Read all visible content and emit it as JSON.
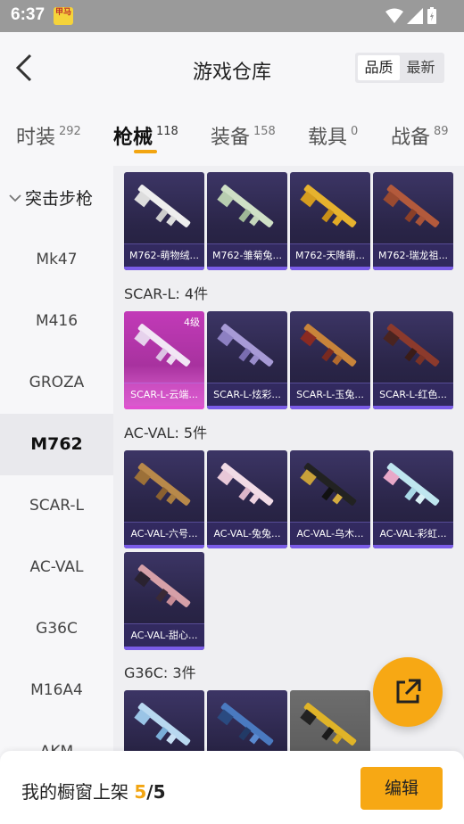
{
  "status": {
    "time": "6:37",
    "app_icon_text": "甲马"
  },
  "header": {
    "title": "游戏仓库",
    "sort": [
      "品质",
      "最新"
    ]
  },
  "tabs": [
    {
      "label": "时装",
      "count": "292"
    },
    {
      "label": "枪械",
      "count": "118"
    },
    {
      "label": "装备",
      "count": "158"
    },
    {
      "label": "载具",
      "count": "0"
    },
    {
      "label": "战备",
      "count": "89"
    }
  ],
  "sidebar": {
    "category": "突击步枪",
    "items": [
      "Mk47",
      "M416",
      "GROZA",
      "M762",
      "SCAR-L",
      "AC-VAL",
      "G36C",
      "M16A4",
      "AKM"
    ]
  },
  "sections": {
    "m762": {
      "cards": [
        "M762-萌物绒...",
        "M762-雏菊兔...",
        "M762-天降萌...",
        "M762-瑞龙祖..."
      ]
    },
    "scarl": {
      "title": "SCAR-L: 4件",
      "grade": "4级",
      "cards": [
        "SCAR-L-云端...",
        "SCAR-L-炫彩...",
        "SCAR-L-玉兔...",
        "SCAR-L-红色..."
      ]
    },
    "acval": {
      "title": "AC-VAL: 5件",
      "cards": [
        "AC-VAL-六号...",
        "AC-VAL-兔兔...",
        "AC-VAL-乌木...",
        "AC-VAL-彩虹...",
        "AC-VAL-甜心..."
      ]
    },
    "g36c": {
      "title": "G36C: 3件"
    }
  },
  "bottom": {
    "label": "我的橱窗上架",
    "count": "5",
    "sep": "/",
    "total": "5",
    "edit": "编辑"
  },
  "colors": {
    "accent": "#f7a814",
    "card_purple": "#2a2548",
    "card_pink": "#c23ab8"
  }
}
